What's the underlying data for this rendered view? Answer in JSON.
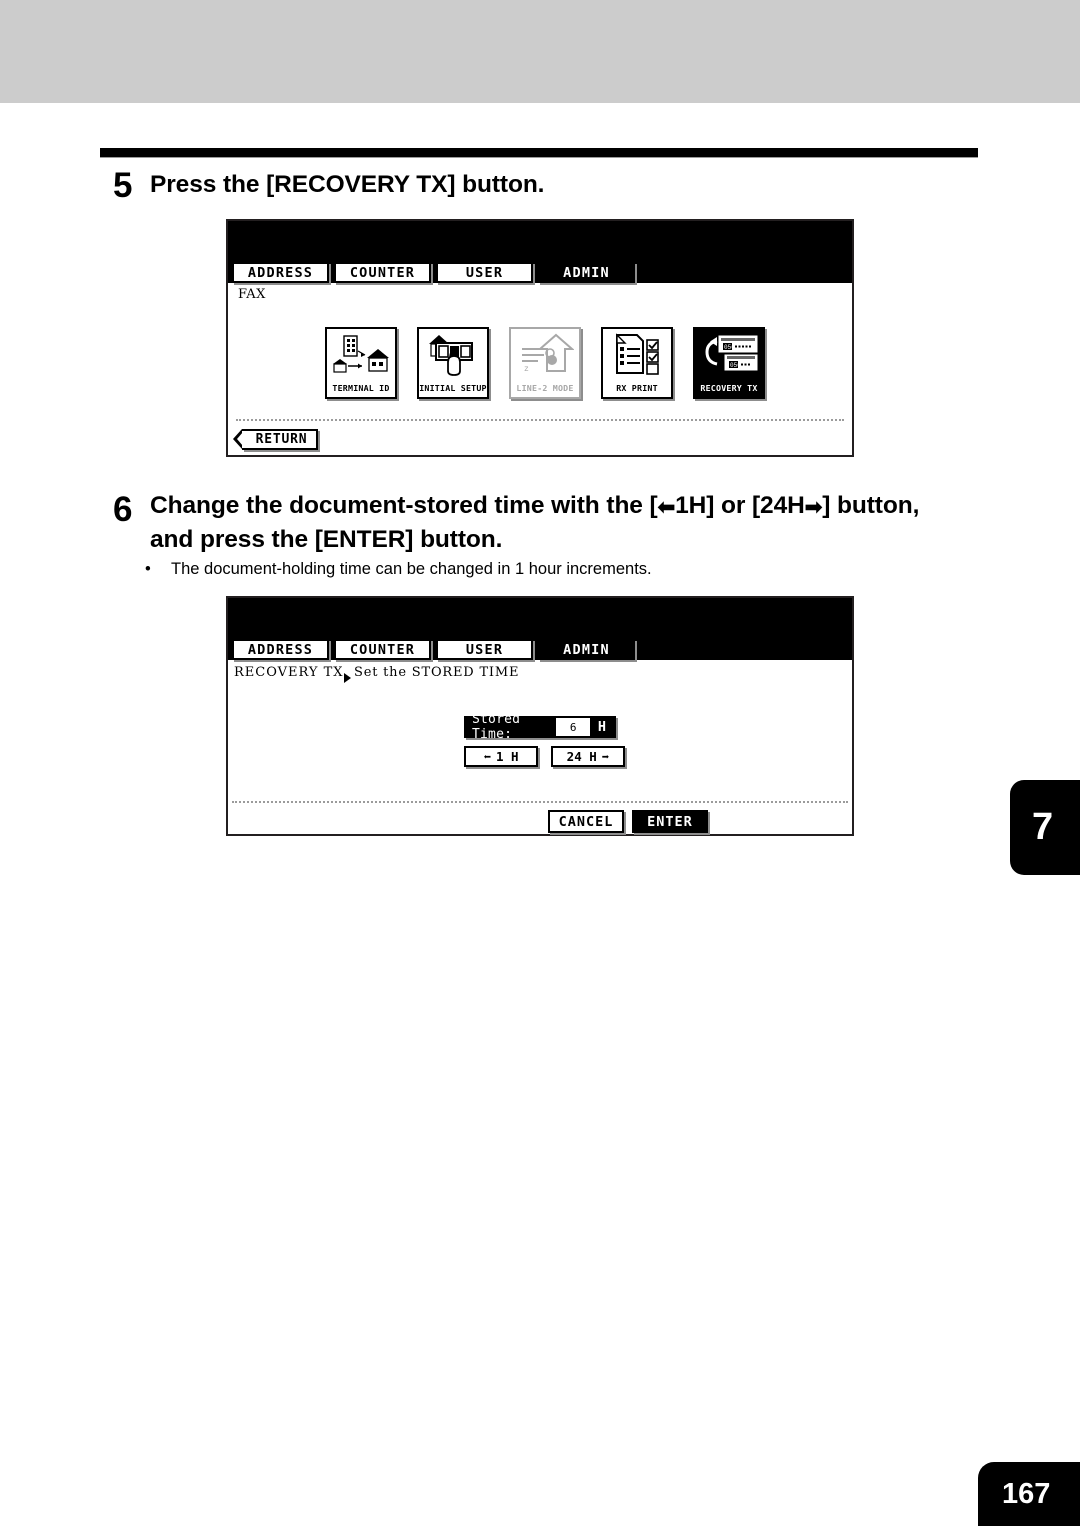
{
  "document": {
    "page_number": "167",
    "chapter_tab": "7"
  },
  "steps": [
    {
      "number": "5",
      "title": "Press the [RECOVERY TX] button."
    },
    {
      "number": "6",
      "title_line1_a": "Change the document-stored time with the [",
      "title_line1_b": "1H] or [24H",
      "title_line1_c": "] button,",
      "title_line2": "and press the [ENTER] button.",
      "bullet": "The document-holding time can be changed in 1 hour increments."
    }
  ],
  "panel1": {
    "tabs": [
      {
        "label": "ADDRESS",
        "selected": false
      },
      {
        "label": "COUNTER",
        "selected": false
      },
      {
        "label": "USER",
        "selected": false
      },
      {
        "label": "ADMIN",
        "selected": true
      }
    ],
    "caption": "FAX",
    "icons": [
      {
        "label": "TERMINAL ID",
        "icon": "building-house-icon",
        "state": "normal"
      },
      {
        "label": "INITIAL SETUP",
        "icon": "hand-panel-icon",
        "state": "normal"
      },
      {
        "label": "LINE-2 MODE",
        "icon": "house-arrow-icon",
        "state": "disabled"
      },
      {
        "label": "RX PRINT",
        "icon": "document-checklist-icon",
        "state": "normal"
      },
      {
        "label": "RECOVERY TX",
        "icon": "recovery-fax-icon",
        "state": "selected"
      }
    ],
    "return_label": "RETURN"
  },
  "panel2": {
    "tabs": [
      {
        "label": "ADDRESS",
        "selected": false
      },
      {
        "label": "COUNTER",
        "selected": false
      },
      {
        "label": "USER",
        "selected": false
      },
      {
        "label": "ADMIN",
        "selected": true
      }
    ],
    "breadcrumb_left": "RECOVERY TX",
    "breadcrumb_right": "Set the STORED TIME",
    "stored_time": {
      "label": "Stored Time:",
      "value": "6",
      "unit": "H"
    },
    "decrement_label": "1 H",
    "increment_label": "24 H",
    "cancel_label": "CANCEL",
    "enter_label": "ENTER"
  }
}
